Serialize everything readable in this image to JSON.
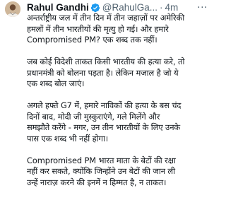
{
  "tweet": {
    "display_name": "Rahul Gandhi",
    "handle": "@RahulGa...",
    "separator": "·",
    "time": "4m",
    "more_label": "···",
    "icons": {
      "verified": "verified-badge-icon",
      "more": "more-options-icon",
      "avatar": "profile-avatar"
    },
    "colors": {
      "verified": "#1d9bf0",
      "secondary_text": "#536471",
      "primary_text": "#0f1419"
    },
    "paragraphs": [
      {
        "lines": [
          "अन्तर्राष्ट्रीय जल में तीन दिन में तीन जहाज़ों पर अमेरिकी",
          "हमलों में तीन भारतीयों की मृत्यु हो गई। और हमारे",
          "Compromised PM? एक शब्द तक नहीं।"
        ]
      },
      {
        "lines": [
          "जब कोई विदेशी ताकत किसी भारतीय की हत्या करे, तो",
          "प्रधानमंत्री को बोलना पड़ता है। लेकिन मजाल है जो ये",
          "एक शब्द बोल जाएं।"
        ]
      },
      {
        "lines": [
          "अगले हफ्ते G7 में, हमारे नाविकों की हत्या के बस चंद",
          "दिनों बाद, मोदी जी मुस्कुराएंगे, गले मिलेंगे और",
          "समझौते करेंगे - मगर, उन तीन भारतीयों के लिए उनके",
          "पास एक शब्द भी नहीं होगा।"
        ]
      },
      {
        "lines": [
          "Compromised PM भारत माता के बेटों की रक्षा",
          "नहीं कर सकते, क्योंकि जिन्होंने उन बेटों की जान ली",
          "उन्हें नाराज़ करने की इनमें न हिम्मत है, न ताकत।"
        ]
      }
    ]
  }
}
